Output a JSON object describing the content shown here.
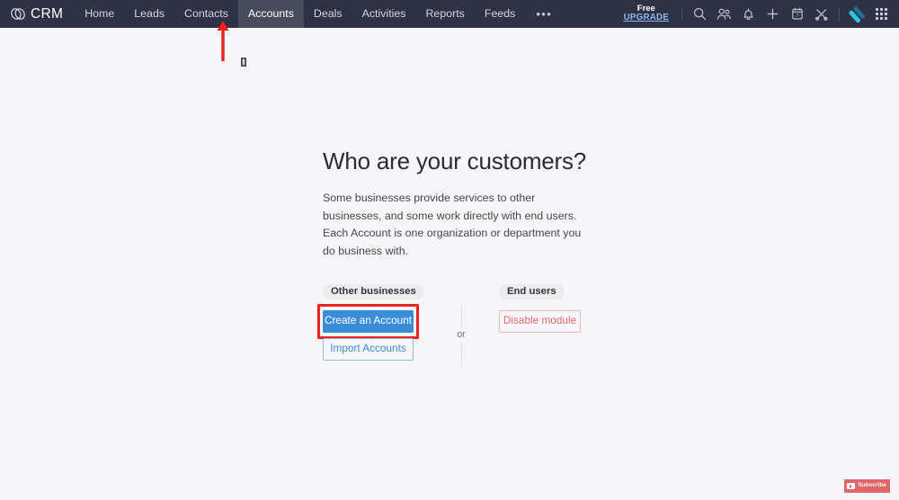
{
  "app": {
    "brand_name": "CRM",
    "brand_icon": "interlocking-rings-logo"
  },
  "nav": {
    "tabs": [
      {
        "label": "Home",
        "active": false
      },
      {
        "label": "Leads",
        "active": false
      },
      {
        "label": "Contacts",
        "active": false
      },
      {
        "label": "Accounts",
        "active": true
      },
      {
        "label": "Deals",
        "active": false
      },
      {
        "label": "Activities",
        "active": false
      },
      {
        "label": "Reports",
        "active": false
      },
      {
        "label": "Feeds",
        "active": false
      }
    ],
    "more_label": "•••"
  },
  "toolbar": {
    "plan_label": "Free",
    "upgrade_label": "UPGRADE",
    "icons": [
      "search-icon",
      "people-icon",
      "bell-icon",
      "plus-icon",
      "calendar-icon",
      "tools-icon"
    ],
    "product_logo_icon": "zoho-diamond-logo",
    "apps_grid_icon": "apps-grid-icon"
  },
  "main": {
    "heading": "Who are your customers?",
    "description": "Some businesses provide services to other businesses, and some work directly with end users. Each Account is one organization or department you do business with.",
    "left_chip": "Other businesses",
    "right_chip": "End users",
    "divider_label": "or",
    "buttons": {
      "create": "Create an Account",
      "import": "Import Accounts",
      "disable": "Disable module"
    }
  },
  "annotations": {
    "arrow_target": "Accounts",
    "arrow_color": "#ee2020",
    "highlight_target": "Create an Account",
    "highlight_color": "#ee2020"
  },
  "overlay": {
    "subscribe_label": "Subscribe"
  },
  "colors": {
    "topbar_bg": "#2e3244",
    "active_tab_bg": "#474b5c",
    "page_bg": "#f6f6fa",
    "primary_blue": "#3c8dd9",
    "danger_red": "#e56a6a",
    "accent_cyan": "#29c2d8",
    "upgrade_link": "#8ab8ea"
  }
}
